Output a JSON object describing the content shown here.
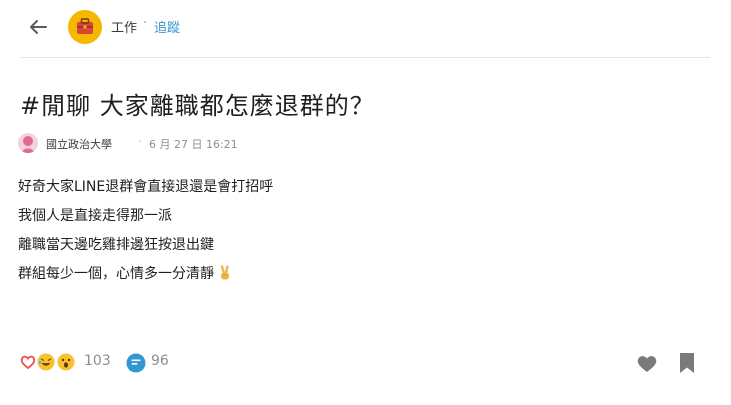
{
  "header": {
    "board_name": "工作",
    "separator": "·",
    "follow_label": "追蹤"
  },
  "post": {
    "title": "#閒聊 大家離職都怎麼退群的？",
    "author_school": "國立政治大學",
    "meta_separator": "·",
    "posted_at": "6 月 27 日 16:21",
    "content_lines": [
      "好奇大家LINE退群會直接退還是會打招呼",
      "我個人是直接走得那一派",
      "離職當天邊吃雞排邊狂按退出鍵",
      "群組每少一個，心情多一分清靜"
    ],
    "trailing_emoji": "victory-hand-icon"
  },
  "footer": {
    "reaction_icons": [
      "heart-reaction-icon",
      "laugh-reaction-icon",
      "surprised-reaction-icon"
    ],
    "reaction_count": "103",
    "comment_count": "96"
  },
  "colors": {
    "accent_blue": "#3397cf",
    "text_gray": "#8e8e8e",
    "board_yellow": "#f5b800",
    "reaction_red": "#f05050",
    "reaction_yellow": "#fbc02d",
    "icon_gray": "#7a7a7a"
  }
}
